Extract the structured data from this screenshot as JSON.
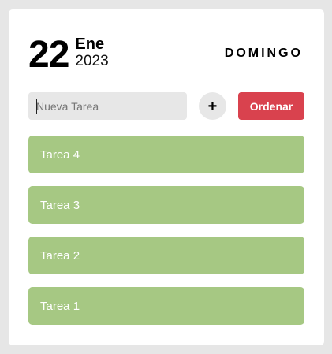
{
  "date": {
    "day": "22",
    "month": "Ene",
    "year": "2023",
    "weekday": "DOMINGO"
  },
  "form": {
    "input_placeholder": "Nueva Tarea",
    "input_value": "",
    "add_label": "+",
    "order_label": "Ordenar"
  },
  "tasks": [
    {
      "label": "Tarea 4"
    },
    {
      "label": "Tarea 3"
    },
    {
      "label": "Tarea 2"
    },
    {
      "label": "Tarea 1"
    }
  ],
  "colors": {
    "background": "#e6e6e6",
    "card": "#ffffff",
    "task_bg": "#a6c883",
    "order_button_bg": "#d9424e",
    "input_bg": "#e7e7e7"
  }
}
